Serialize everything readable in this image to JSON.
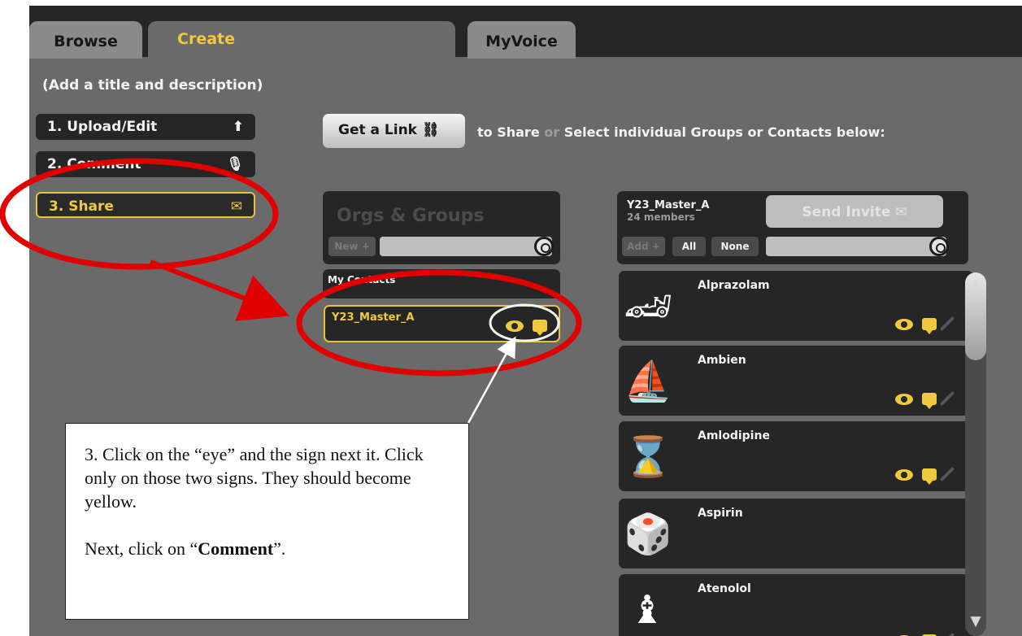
{
  "tabs": [
    {
      "label": "Browse",
      "active": false
    },
    {
      "label": "Create",
      "active": true
    },
    {
      "label": "MyVoice",
      "active": false
    }
  ],
  "subtitle": "(Add a title and description)",
  "steps": [
    {
      "label": "1. Upload/Edit",
      "icon": "upload-icon"
    },
    {
      "label": "2. Comment",
      "icon": "microphone-icon"
    },
    {
      "label": "3. Share",
      "icon": "envelope-icon",
      "active": true
    }
  ],
  "share_bar": {
    "get_link": "Get a Link",
    "to_share": "to Share",
    "or": "or",
    "select_text": "Select individual Groups or Contacts below:"
  },
  "orgs_panel": {
    "title": "Orgs & Groups",
    "new_button": "New +",
    "section_label": "My Contacts",
    "group_name": "Y23_Master_A"
  },
  "members_panel": {
    "group_name": "Y23_Master_A",
    "members": "24 members",
    "send_invite": "Send Invite",
    "add_button": "Add +",
    "all_button": "All",
    "none_button": "None"
  },
  "contacts": [
    {
      "name": "Alprazolam",
      "avatar": "car-icon",
      "glyph": "🏎"
    },
    {
      "name": "Ambien",
      "avatar": "boat-icon",
      "glyph": "⛵"
    },
    {
      "name": "Amlodipine",
      "avatar": "hourglass-icon",
      "glyph": "⌛"
    },
    {
      "name": "Aspirin",
      "avatar": "dice-icon",
      "glyph": "🎲"
    },
    {
      "name": "Atenolol",
      "avatar": "chess-bishop-icon",
      "glyph": "♝"
    }
  ],
  "callout": {
    "line1": "3. Click on the “eye” and the sign next it. Click only on those two signs. They should become yellow.",
    "next_prefix": "Next, click on “",
    "next_bold": "Comment",
    "next_suffix": "”."
  },
  "colors": {
    "accent": "#f1c93e",
    "background": "#6a6a6a",
    "panel": "#262626",
    "annotation": "#e00000"
  }
}
